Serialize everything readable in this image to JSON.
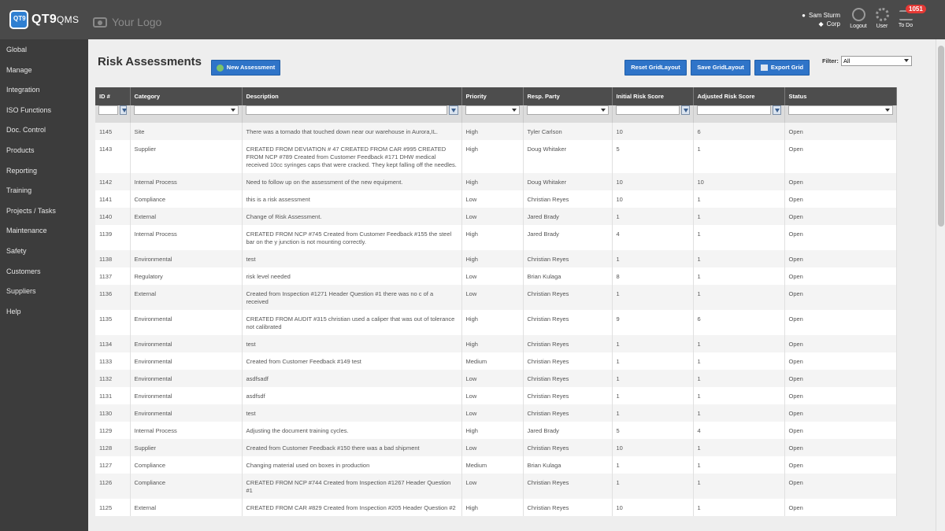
{
  "header": {
    "logo_badge": "QT9",
    "logo_name": "QT9",
    "logo_suffix": "QMS",
    "placeholder_logo": "Your Logo",
    "user_name": "Sam Sturm",
    "user_company": "Corp",
    "logout_label": "Logout",
    "user_label": "User",
    "todo_label": "To Do",
    "todo_count": "1051"
  },
  "sidebar": {
    "items": [
      {
        "label": "Global"
      },
      {
        "label": "Manage"
      },
      {
        "label": "Integration"
      },
      {
        "label": "ISO Functions"
      },
      {
        "label": "Doc. Control"
      },
      {
        "label": "Products"
      },
      {
        "label": "Reporting"
      },
      {
        "label": "Training"
      },
      {
        "label": "Projects / Tasks"
      },
      {
        "label": "Maintenance"
      },
      {
        "label": "Safety"
      },
      {
        "label": "Customers"
      },
      {
        "label": "Suppliers"
      },
      {
        "label": "Help"
      }
    ]
  },
  "page": {
    "title": "Risk Assessments",
    "new_button": "New Assessment",
    "reset_button": "Reset GridLayout",
    "save_button": "Save GridLayout",
    "export_button": "Export Grid",
    "filter_label": "Filter:",
    "filter_value": "All"
  },
  "grid": {
    "columns": [
      "ID #",
      "Category",
      "Description",
      "Priority",
      "Resp. Party",
      "Initial Risk Score",
      "Adjusted Risk Score",
      "Status"
    ],
    "rows": [
      [
        "1145",
        "Site",
        "There was a tornado that touched down near our warehouse in Aurora,IL.",
        "High",
        "Tyler Carlson",
        "10",
        "6",
        "Open"
      ],
      [
        "1143",
        "Supplier",
        "CREATED FROM DEVIATION # 47 CREATED FROM CAR #995 CREATED FROM NCP #789 Created from Customer Feedback #171 DHW medical received 10cc syringes caps that were cracked. They kept falling off the needles.",
        "High",
        "Doug Whitaker",
        "5",
        "1",
        "Open"
      ],
      [
        "1142",
        "Internal Process",
        "Need to follow up on the assessment of the new equipment.",
        "High",
        "Doug Whitaker",
        "10",
        "10",
        "Open"
      ],
      [
        "1141",
        "Compliance",
        "this is a risk assessment",
        "Low",
        "Christian Reyes",
        "10",
        "1",
        "Open"
      ],
      [
        "1140",
        "External",
        "Change of Risk Assessment.",
        "Low",
        "Jared Brady",
        "1",
        "1",
        "Open"
      ],
      [
        "1139",
        "Internal Process",
        "CREATED FROM NCP #745 Created from Customer Feedback #155 the steel bar on the y junction is not mounting correctly.",
        "High",
        "Jared Brady",
        "4",
        "1",
        "Open"
      ],
      [
        "1138",
        "Environmental",
        "test",
        "High",
        "Christian Reyes",
        "1",
        "1",
        "Open"
      ],
      [
        "1137",
        "Regulatory",
        "risk level needed",
        "Low",
        "Brian Kulaga",
        "8",
        "1",
        "Open"
      ],
      [
        "1136",
        "External",
        "Created from Inspection #1271 Header Question #1 there was no c of a received",
        "Low",
        "Christian Reyes",
        "1",
        "1",
        "Open"
      ],
      [
        "1135",
        "Environmental",
        "CREATED FROM AUDIT #315 christian used a caliper that was out of tolerance not calibrated",
        "High",
        "Christian Reyes",
        "9",
        "6",
        "Open"
      ],
      [
        "1134",
        "Environmental",
        "test",
        "High",
        "Christian Reyes",
        "1",
        "1",
        "Open"
      ],
      [
        "1133",
        "Environmental",
        "Created from Customer Feedback #149 test",
        "Medium",
        "Christian Reyes",
        "1",
        "1",
        "Open"
      ],
      [
        "1132",
        "Environmental",
        "asdfsadf",
        "Low",
        "Christian Reyes",
        "1",
        "1",
        "Open"
      ],
      [
        "1131",
        "Environmental",
        "asdfsdf",
        "Low",
        "Christian Reyes",
        "1",
        "1",
        "Open"
      ],
      [
        "1130",
        "Environmental",
        "test",
        "Low",
        "Christian Reyes",
        "1",
        "1",
        "Open"
      ],
      [
        "1129",
        "Internal Process",
        "Adjusting the document training cycles.",
        "High",
        "Jared Brady",
        "5",
        "4",
        "Open"
      ],
      [
        "1128",
        "Supplier",
        "Created from Customer Feedback #150 there was a bad shipment",
        "Low",
        "Christian Reyes",
        "10",
        "1",
        "Open"
      ],
      [
        "1127",
        "Compliance",
        "Changing material used on boxes in production",
        "Medium",
        "Brian Kulaga",
        "1",
        "1",
        "Open"
      ],
      [
        "1126",
        "Compliance",
        "CREATED FROM NCP #744 Created from Inspection #1267 Header Question #1",
        "Low",
        "Christian Reyes",
        "1",
        "1",
        "Open"
      ],
      [
        "1125",
        "External",
        "CREATED FROM CAR #829 Created from Inspection #205 Header Question #2",
        "High",
        "Christian Reyes",
        "10",
        "1",
        "Open"
      ]
    ]
  }
}
